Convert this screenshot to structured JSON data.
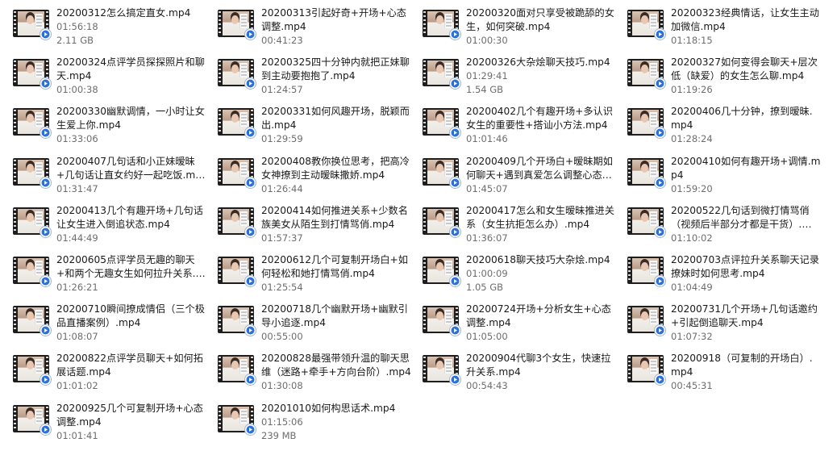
{
  "files": [
    {
      "name": "20200312怎么搞定直女.mp4",
      "duration": "01:56:18",
      "size": "2.11 GB"
    },
    {
      "name": "20200313引起好奇+开场+心态调整.mp4",
      "duration": "00:41:23",
      "size": ""
    },
    {
      "name": "20200320面对只享受被跪舔的女生，如何突破.mp4",
      "duration": "01:00:30",
      "size": ""
    },
    {
      "name": "20200323经典情话，让女生主动加微信.mp4",
      "duration": "01:18:15",
      "size": ""
    },
    {
      "name": "20200324点评学员探探照片和聊天.mp4",
      "duration": "01:00:38",
      "size": ""
    },
    {
      "name": "20200325四十分钟内就把正妹聊到主动要抱抱了.mp4",
      "duration": "01:24:57",
      "size": ""
    },
    {
      "name": "20200326大杂烩聊天技巧.mp4",
      "duration": "01:29:41",
      "size": "1.54 GB"
    },
    {
      "name": "20200327如何变得会聊天+层次低（缺爱）的女生怎么聊.mp4",
      "duration": "01:19:26",
      "size": ""
    },
    {
      "name": "20200330幽默调情，一小时让女生爱上你.mp4",
      "duration": "01:33:06",
      "size": ""
    },
    {
      "name": "20200331如何风趣开场，脱颖而出.mp4",
      "duration": "01:29:59",
      "size": ""
    },
    {
      "name": "20200402几个有趣开场+多认识女生的重要性+搭讪小方法.mp4",
      "duration": "01:01:46",
      "size": ""
    },
    {
      "name": "20200406几十分钟，撩到暧昧.mp4",
      "duration": "01:28:24",
      "size": ""
    },
    {
      "name": "20200407几句话和小正妹暧昧+几句话让直女约好一起吃饭.mp4",
      "duration": "01:31:47",
      "size": ""
    },
    {
      "name": "20200408教你换位思考，把高冷女神撩到主动暧昧撒娇.mp4",
      "duration": "01:26:44",
      "size": ""
    },
    {
      "name": "20200409几个开场白+暧昧期如何聊天+遇到真爱怎么调整心态+几...",
      "duration": "01:45:07",
      "size": ""
    },
    {
      "name": "20200410如何有趣开场+调情.mp4",
      "duration": "01:59:20",
      "size": ""
    },
    {
      "name": "20200413几个有趣开场+几句话让女生进入倒追状态.mp4",
      "duration": "01:44:49",
      "size": ""
    },
    {
      "name": "20200414如何推进关系+少数名族美女从陌生到打情骂俏.mp4",
      "duration": "01:57:37",
      "size": ""
    },
    {
      "name": "20200417怎么和女生暧昧推进关系（女生抗拒怎么办）.mp4",
      "duration": "01:36:07",
      "size": ""
    },
    {
      "name": "20200522几句话到微打情骂俏（视频后半部分才都是干货）.mp4",
      "duration": "01:10:02",
      "size": ""
    },
    {
      "name": "20200605点评学员无趣的聊天+和两个无趣女生如何拉升关系.mp4",
      "duration": "01:26:21",
      "size": ""
    },
    {
      "name": "20200612几个可复制开场白+如何轻松和她打情骂俏.mp4",
      "duration": "01:25:54",
      "size": ""
    },
    {
      "name": "20200618聊天技巧大杂烩.mp4",
      "duration": "01:00:09",
      "size": "1.05 GB"
    },
    {
      "name": "20200703点评拉升关系聊天记录撩妹时如何思考.mp4",
      "duration": "01:04:49",
      "size": ""
    },
    {
      "name": "20200710瞬间撩成情侣（三个极品直播案例）.mp4",
      "duration": "01:08:07",
      "size": ""
    },
    {
      "name": "20200718几个幽默开场+幽默引导小追逐.mp4",
      "duration": "00:55:00",
      "size": ""
    },
    {
      "name": "20200724开场+分析女生+心态调整.mp4",
      "duration": "01:05:00",
      "size": ""
    },
    {
      "name": "20200731几个开场+几句话邀约+引起倒追聊天.mp4",
      "duration": "01:07:32",
      "size": ""
    },
    {
      "name": "20200822点评学员聊天+如何拓展话题.mp4",
      "duration": "01:01:02",
      "size": ""
    },
    {
      "name": "20200828最强带领升温的聊天思维（迷路+牵手+方向台阶）.mp4",
      "duration": "01:30:08",
      "size": ""
    },
    {
      "name": "20200904代聊3个女生，快速拉升关系.mp4",
      "duration": "00:54:43",
      "size": ""
    },
    {
      "name": "20200918（可复制的开场白）.mp4",
      "duration": "00:45:31",
      "size": ""
    },
    {
      "name": "20200925几个可复制开场+心态调整.mp4",
      "duration": "01:01:41",
      "size": ""
    },
    {
      "name": "20201010如何构思话术.mp4",
      "duration": "01:15:06",
      "size": "239 MB"
    }
  ]
}
